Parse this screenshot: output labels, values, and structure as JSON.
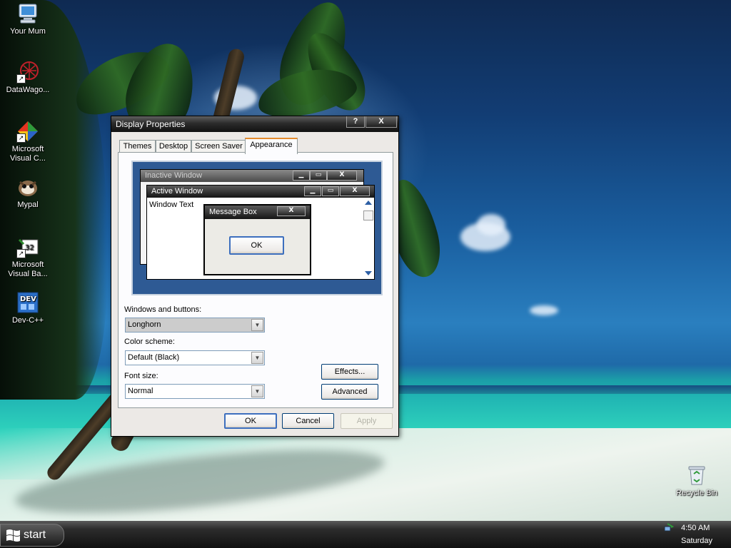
{
  "desktop": {
    "icons": [
      {
        "label": "Your Mum",
        "icon": "computer-icon"
      },
      {
        "label": "DataWago...",
        "icon": "datawagon-icon"
      },
      {
        "label": "Microsoft Visual C...",
        "icon": "visual-c-icon"
      },
      {
        "label": "Mypal",
        "icon": "mypal-icon"
      },
      {
        "label": "Microsoft Visual Ba...",
        "icon": "visual-basic-icon"
      },
      {
        "label": "Dev-C++",
        "icon": "dev-cpp-icon"
      }
    ],
    "recycle_bin": {
      "label": "Recycle Bin",
      "icon": "recycle-bin-icon"
    }
  },
  "dialog": {
    "title": "Display Properties",
    "help_label": "?",
    "close_label": "X",
    "tabs": [
      "Themes",
      "Desktop",
      "Screen Saver",
      "Appearance"
    ],
    "active_tab": "Appearance",
    "preview": {
      "inactive_window_title": "Inactive Window",
      "active_window_title": "Active Window",
      "window_text": "Window Text",
      "message_box_title": "Message Box",
      "message_box_ok": "OK",
      "close_glyph": "X"
    },
    "windows_and_buttons_label": "Windows and buttons:",
    "windows_and_buttons_value": "Longhorn",
    "color_scheme_label": "Color scheme:",
    "color_scheme_value": "Default (Black)",
    "font_size_label": "Font size:",
    "font_size_value": "Normal",
    "effects_label": "Effects...",
    "advanced_label": "Advanced",
    "ok_label": "OK",
    "cancel_label": "Cancel",
    "apply_label": "Apply"
  },
  "taskbar": {
    "start_label": "start",
    "time": "4:50 AM",
    "day": "Saturday"
  },
  "colors": {
    "titlebar": "#2b2b2b",
    "preview_bg": "#2e5a94",
    "active_tab_accent": "#e68b2c",
    "button_border": "#003c74"
  }
}
